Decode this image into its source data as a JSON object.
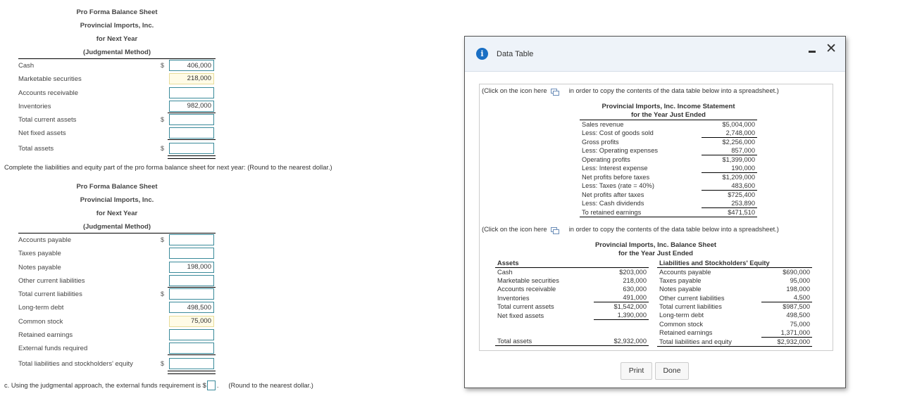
{
  "assets_sheet": {
    "heading": [
      "Pro Forma Balance Sheet",
      "Provincial Imports, Inc.",
      "for Next Year",
      "(Judgmental Method)"
    ],
    "rows": [
      {
        "label": "Cash",
        "dollar": "$",
        "value": "406,000",
        "style": "input"
      },
      {
        "label": "Marketable securities",
        "dollar": "",
        "value": "218,000",
        "style": "given"
      },
      {
        "label": "Accounts receivable",
        "dollar": "",
        "value": "",
        "style": "input"
      },
      {
        "label": "Inventories",
        "dollar": "",
        "value": "982,000",
        "style": "input"
      },
      {
        "label": "Total current assets",
        "dollar": "$",
        "value": "",
        "style": "input"
      },
      {
        "label": "Net fixed assets",
        "dollar": "",
        "value": "",
        "style": "input"
      },
      {
        "label": "Total assets",
        "dollar": "$",
        "value": "",
        "style": "input"
      }
    ]
  },
  "instruction": "Complete the liabilities and equity part of the pro forma balance sheet for next year:  (Round to the nearest dollar.)",
  "liabilities_sheet": {
    "heading": [
      "Pro Forma Balance Sheet",
      "Provincial Imports, Inc.",
      "for Next Year",
      "(Judgmental Method)"
    ],
    "rows": [
      {
        "label": "Accounts payable",
        "dollar": "$",
        "value": "",
        "style": "input"
      },
      {
        "label": "Taxes payable",
        "dollar": "",
        "value": "",
        "style": "input"
      },
      {
        "label": "Notes payable",
        "dollar": "",
        "value": "198,000",
        "style": "input"
      },
      {
        "label": "Other current liabilities",
        "dollar": "",
        "value": "",
        "style": "input"
      },
      {
        "label": "Total current liabilities",
        "dollar": "$",
        "value": "",
        "style": "input"
      },
      {
        "label": "Long-term debt",
        "dollar": "",
        "value": "498,500",
        "style": "input"
      },
      {
        "label": "Common stock",
        "dollar": "",
        "value": "75,000",
        "style": "given"
      },
      {
        "label": "Retained earnings",
        "dollar": "",
        "value": "",
        "style": "input"
      },
      {
        "label": "External funds required",
        "dollar": "",
        "value": "",
        "style": "input"
      },
      {
        "label": "Total liabilities and stockholders' equity",
        "dollar": "$",
        "value": "",
        "style": "input"
      }
    ]
  },
  "part_c": {
    "prefix": "c. Using the judgmental approach, the external funds requirement is $",
    "value": "",
    "suffix": ".",
    "hint": "(Round to the nearest dollar.)"
  },
  "dialog": {
    "title": "Data Table",
    "copy_prefix": "(Click on the icon here",
    "copy_suffix": "in order to copy the contents of the data table below into a spreadsheet.)",
    "income_statement": {
      "title": "Provincial Imports, Inc. Income Statement",
      "subtitle": "for the Year Just Ended",
      "rows": [
        {
          "label": "Sales revenue",
          "value": "$5,004,000"
        },
        {
          "label": "Less: Cost of goods sold",
          "value": "2,748,000"
        },
        {
          "label": "Gross profits",
          "value": "$2,256,000"
        },
        {
          "label": "Less: Operating expenses",
          "value": "857,000"
        },
        {
          "label": "Operating profits",
          "value": "$1,399,000"
        },
        {
          "label": "Less: Interest expense",
          "value": "190,000"
        },
        {
          "label": "Net profits before taxes",
          "value": "$1,209,000"
        },
        {
          "label": "Less: Taxes (rate = 40%)",
          "value": "483,600"
        },
        {
          "label": "Net profits after taxes",
          "value": "$725,400"
        },
        {
          "label": "Less: Cash dividends",
          "value": "253,890"
        },
        {
          "label": "To retained earnings",
          "value": "$471,510"
        }
      ]
    },
    "balance_sheet": {
      "title": "Provincial Imports, Inc. Balance Sheet",
      "subtitle": "for the Year Just Ended",
      "assets_header": "Assets",
      "assets": [
        {
          "label": "Cash",
          "value": "$203,000"
        },
        {
          "label": "Marketable securities",
          "value": "218,000"
        },
        {
          "label": "Accounts receivable",
          "value": "630,000"
        },
        {
          "label": "Inventories",
          "value": "491,000"
        },
        {
          "label": "Total current assets",
          "value": "$1,542,000"
        },
        {
          "label": "Net fixed assets",
          "value": "1,390,000"
        },
        {
          "label": "Total assets",
          "value": "$2,932,000"
        }
      ],
      "liabilities_header": "Liabilities and Stockholders' Equity",
      "liabilities": [
        {
          "label": "Accounts payable",
          "value": "$690,000"
        },
        {
          "label": "Taxes payable",
          "value": "95,000"
        },
        {
          "label": "Notes payable",
          "value": "198,000"
        },
        {
          "label": "Other current liabilities",
          "value": "4,500"
        },
        {
          "label": "Total current liabilities",
          "value": "$987,500"
        },
        {
          "label": "Long-term debt",
          "value": "498,500"
        },
        {
          "label": "Common stock",
          "value": "75,000"
        },
        {
          "label": "Retained earnings",
          "value": "1,371,000"
        },
        {
          "label": "Total liabilities and equity",
          "value": "$2,932,000"
        }
      ]
    },
    "buttons": {
      "print": "Print",
      "done": "Done"
    }
  }
}
